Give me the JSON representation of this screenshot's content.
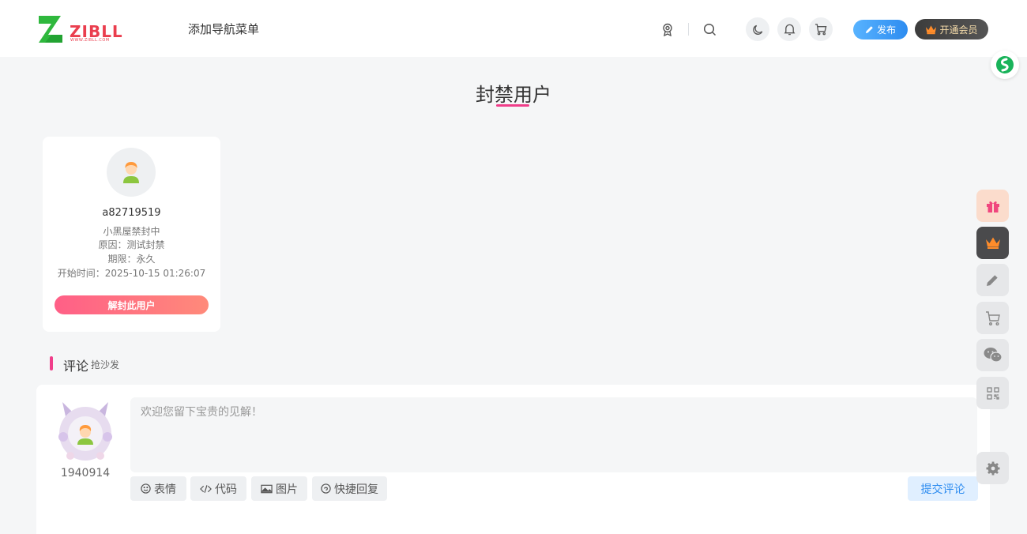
{
  "header": {
    "logo_text": "ZIBLL",
    "logo_sub": "WWW.ZIBLL.COM",
    "nav_menu": "添加导航菜单",
    "publish_label": "发布",
    "vip_label": "开通会员"
  },
  "page": {
    "title": "封禁用户"
  },
  "user_card": {
    "username": "a82719519",
    "status": "小黑屋禁封中",
    "reason": "原因：测试封禁",
    "period": "期限：永久",
    "start_time": "开始时间：2025-10-15 01:26:07",
    "unban_label": "解封此用户"
  },
  "comments": {
    "title": "评论",
    "subtitle": "抢沙发",
    "user_id": "1940914",
    "placeholder": "欢迎您留下宝贵的见解！",
    "tools": {
      "emoji": "表情",
      "code": "代码",
      "image": "图片",
      "quick_reply": "快捷回复"
    },
    "submit_label": "提交评论"
  },
  "colors": {
    "accent_pink": "#f03e8a",
    "publish_blue": "#2d8cf0",
    "unban_gradient_start": "#ff5f87",
    "unban_gradient_end": "#ff8a7a",
    "vip_dark": "#3c3c3c"
  },
  "icons": {
    "header": [
      "medal-icon",
      "search-icon",
      "moon-icon",
      "bell-icon",
      "cart-icon"
    ],
    "float_toolbar": [
      "gift-icon",
      "crown-icon",
      "pencil-icon",
      "cart-icon",
      "wechat-icon",
      "qrcode-icon",
      "settings-icon"
    ]
  }
}
